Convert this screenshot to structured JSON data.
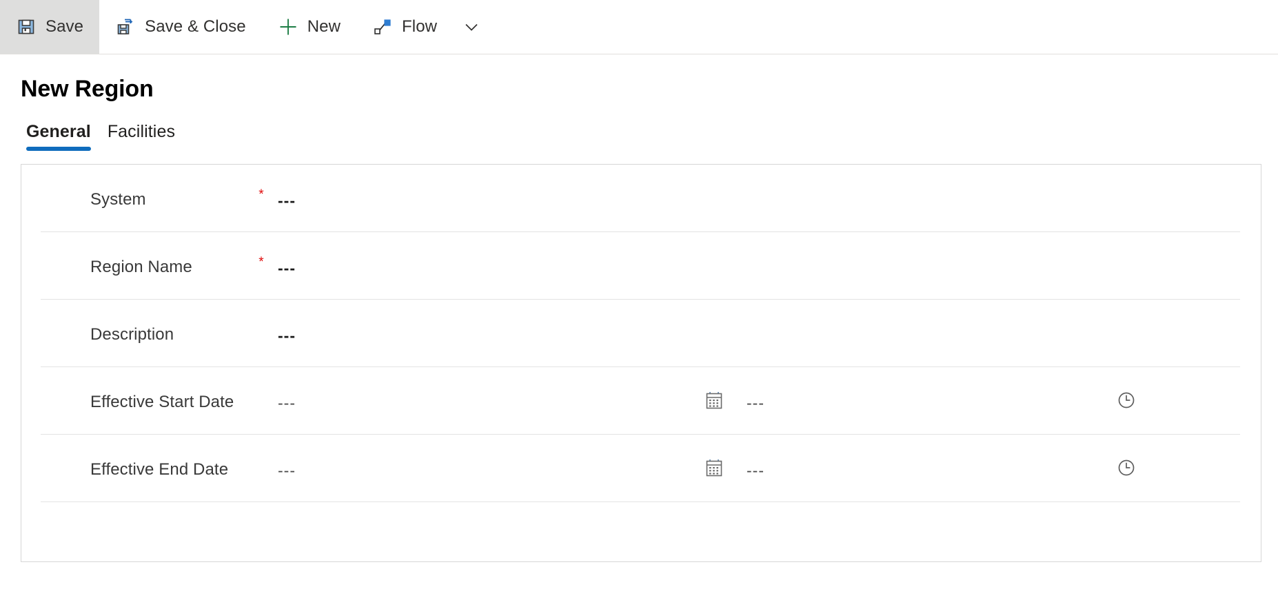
{
  "command_bar": {
    "buttons": [
      {
        "id": "save",
        "label": "Save",
        "icon": "save-icon",
        "active": true
      },
      {
        "id": "save-close",
        "label": "Save & Close",
        "icon": "save-and-close-icon",
        "active": false
      },
      {
        "id": "new",
        "label": "New",
        "icon": "plus-icon",
        "active": false
      },
      {
        "id": "flow",
        "label": "Flow",
        "icon": "flow-icon",
        "active": false
      }
    ],
    "overflow": {
      "label": "",
      "icon": "chevron-down-icon"
    }
  },
  "header": {
    "title": "New Region"
  },
  "tabs": [
    {
      "id": "general",
      "label": "General",
      "selected": true
    },
    {
      "id": "facilities",
      "label": "Facilities",
      "selected": false
    }
  ],
  "form": {
    "fields": [
      {
        "id": "system",
        "label": "System",
        "required": true,
        "value": "---",
        "value_style": "bold",
        "type": "lookup"
      },
      {
        "id": "region-name",
        "label": "Region Name",
        "required": true,
        "value": "---",
        "value_style": "bold",
        "type": "text"
      },
      {
        "id": "description",
        "label": "Description",
        "required": false,
        "value": "---",
        "value_style": "bold",
        "type": "text"
      },
      {
        "id": "effective-start-date",
        "label": "Effective Start Date",
        "required": false,
        "value": "---",
        "value_style": "light",
        "type": "datetime",
        "time_value": "---",
        "date_icon": "calendar-icon",
        "time_icon": "clock-icon"
      },
      {
        "id": "effective-end-date",
        "label": "Effective End Date",
        "required": false,
        "value": "---",
        "value_style": "light",
        "type": "datetime",
        "time_value": "---",
        "date_icon": "calendar-icon",
        "time_icon": "clock-icon"
      }
    ],
    "required_marker": "*"
  },
  "colors": {
    "accent": "#0f6cbd",
    "required": "#e00b0b",
    "icon_blue": "#4a90d9",
    "icon_gray": "#5d5d5d",
    "divider": "#e3e3e3",
    "card_border": "#d6d6d6",
    "active_button_bg": "#dededd"
  }
}
